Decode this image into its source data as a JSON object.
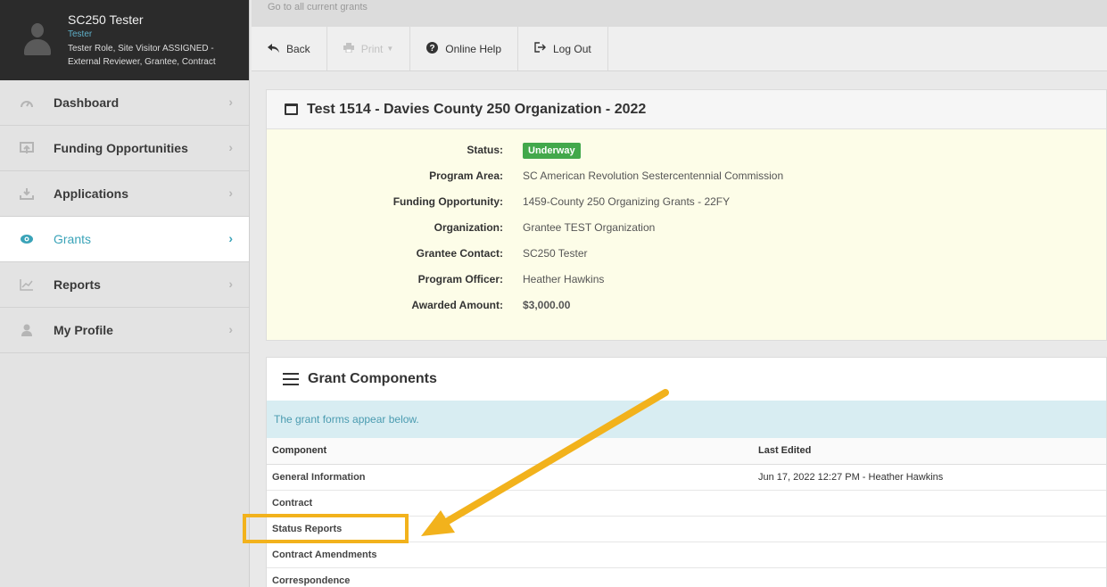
{
  "breadcrumb": "Go to all current grants",
  "user": {
    "name": "SC250 Tester",
    "role": "Tester",
    "roles_desc": "Tester Role, Site Visitor ASSIGNED - External Reviewer, Grantee, Contract"
  },
  "sidebar": {
    "items": [
      {
        "label": "Dashboard",
        "icon": "dashboard-icon"
      },
      {
        "label": "Funding Opportunities",
        "icon": "upload-icon"
      },
      {
        "label": "Applications",
        "icon": "download-icon"
      },
      {
        "label": "Grants",
        "icon": "eye-icon",
        "active": true
      },
      {
        "label": "Reports",
        "icon": "chart-icon"
      },
      {
        "label": "My Profile",
        "icon": "user-icon"
      }
    ]
  },
  "toolbar": {
    "back": "Back",
    "print": "Print",
    "help": "Online Help",
    "logout": "Log Out"
  },
  "grant": {
    "title": "Test 1514 - Davies County 250 Organization - 2022",
    "fields": {
      "status_label": "Status:",
      "status": "Underway",
      "program_area_label": "Program Area:",
      "program_area": "SC American Revolution Sestercentennial Commission",
      "funding_label": "Funding Opportunity:",
      "funding": "1459-County 250 Organizing Grants - 22FY",
      "org_label": "Organization:",
      "org": "Grantee TEST Organization",
      "contact_label": "Grantee Contact:",
      "contact": "SC250 Tester",
      "officer_label": "Program Officer:",
      "officer": "Heather Hawkins",
      "amount_label": "Awarded Amount:",
      "amount": "$3,000.00"
    }
  },
  "components": {
    "title": "Grant Components",
    "note": "The grant forms appear below.",
    "col_component": "Component",
    "col_last_edited": "Last Edited",
    "rows": [
      {
        "name": "General Information",
        "edited": "Jun 17, 2022 12:27 PM - Heather Hawkins"
      },
      {
        "name": "Contract",
        "edited": ""
      },
      {
        "name": "Status Reports",
        "edited": ""
      },
      {
        "name": "Contract Amendments",
        "edited": ""
      },
      {
        "name": "Correspondence",
        "edited": ""
      }
    ]
  },
  "colors": {
    "accent": "#3aa3b8",
    "status_green": "#42a84b",
    "highlight": "#f2b21c",
    "info_bg": "#fdfde8"
  }
}
